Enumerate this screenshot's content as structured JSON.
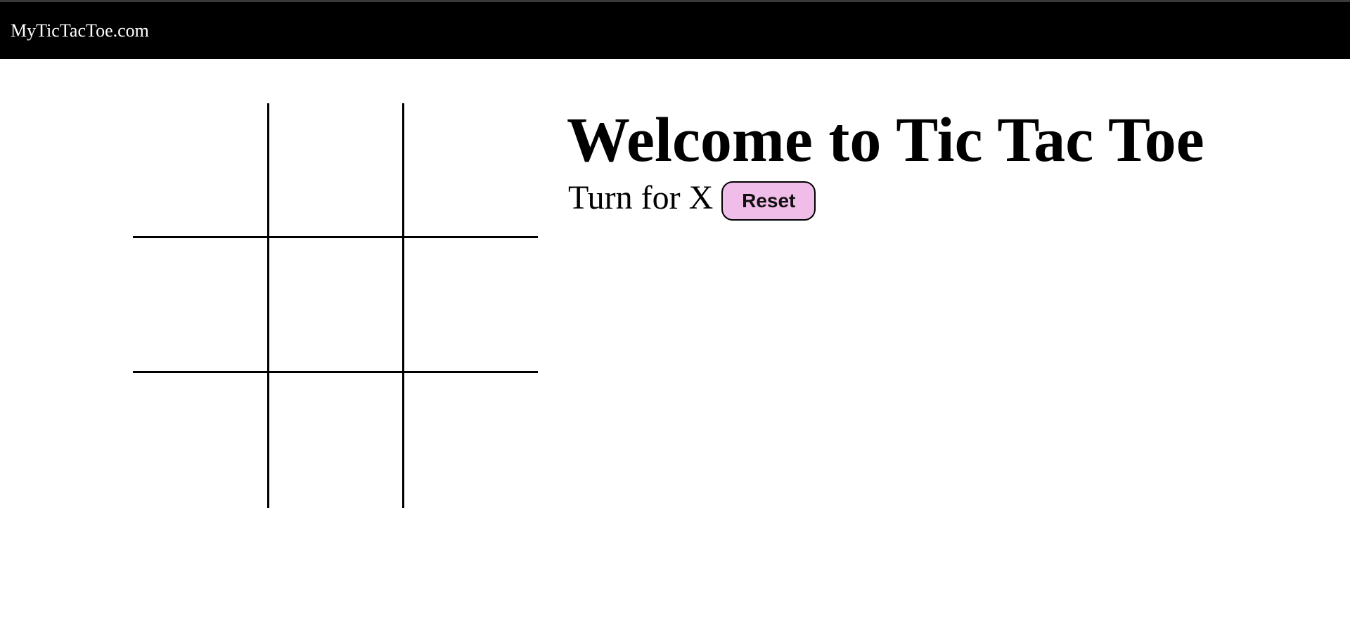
{
  "navbar": {
    "brand": "MyTicTacToe.com"
  },
  "main": {
    "title": "Welcome to Tic Tac Toe",
    "turn_text": "Turn for X",
    "reset_label": "Reset"
  },
  "board": {
    "cells": [
      "",
      "",
      "",
      "",
      "",
      "",
      "",
      "",
      ""
    ]
  },
  "colors": {
    "navbar_bg": "#000000",
    "reset_bg": "#f0bce8"
  }
}
